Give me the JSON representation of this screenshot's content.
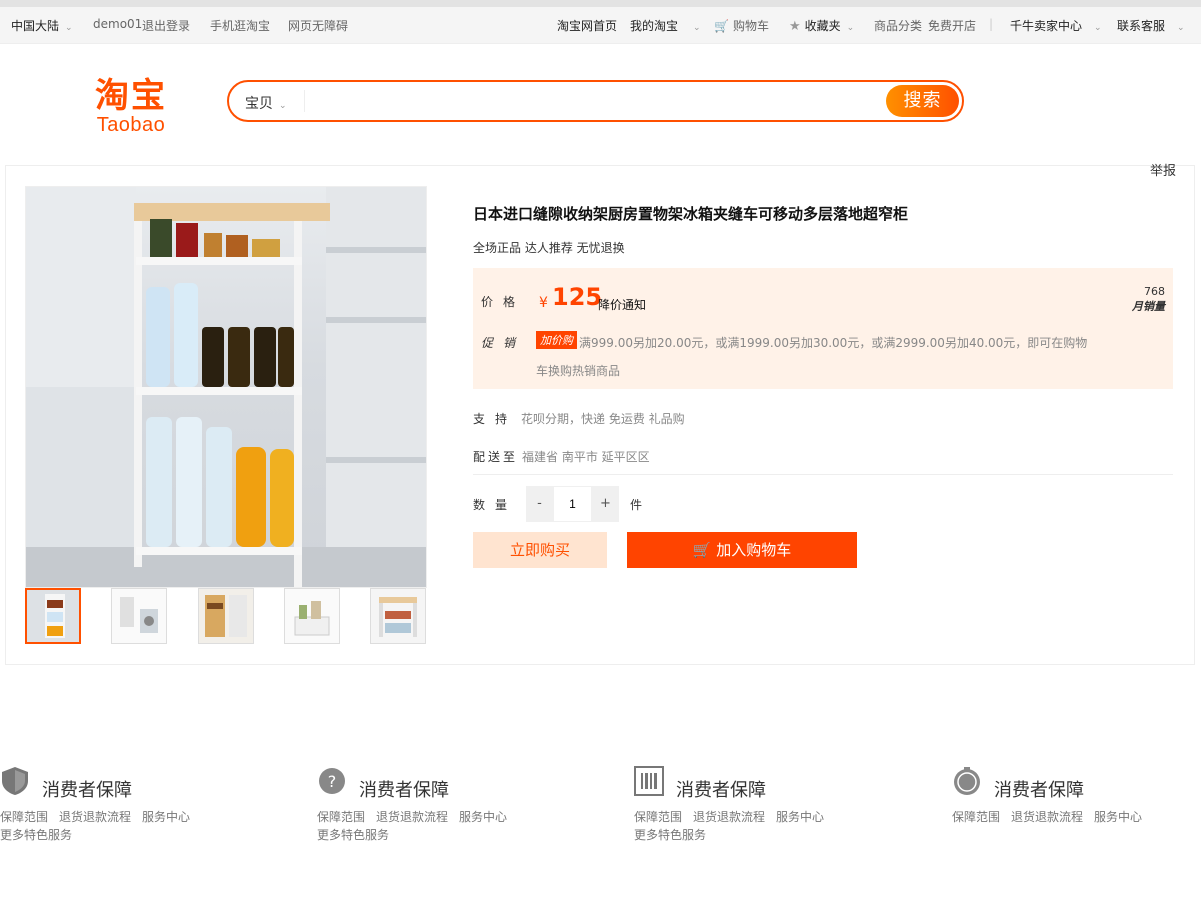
{
  "topbar": {
    "region": "中国大陆",
    "user": "demo01",
    "logout": "退出登录",
    "mobile": "手机逛淘宝",
    "accessible": "网页无障碍",
    "home": "淘宝网首页",
    "my_taobao": "我的淘宝",
    "cart": "购物车",
    "favorites": "收藏夹",
    "categories": "商品分类",
    "open_shop": "免费开店",
    "seller_center": "千牛卖家中心",
    "contact": "联系客服"
  },
  "header": {
    "logo_zh": "淘宝",
    "logo_en": "Taobao",
    "search_category": "宝贝",
    "search_placeholder": "",
    "search_button": "搜索"
  },
  "product": {
    "report": "举报",
    "title": "日本进口缝隙收纳架厨房置物架冰箱夹缝车可移动多层落地超窄柜",
    "subtitle": "全场正品 达人推荐 无忧退换",
    "price_label": "价格",
    "currency": "¥",
    "price": "125",
    "price_notice": "降价通知",
    "monthly_sales": "768",
    "monthly_sales_label": "月销量",
    "promo_label": "促销",
    "promo_tag": "加价购",
    "promo_text": "满999.00另加20.00元，或满1999.00另加30.00元，或满2999.00另加40.00元，即可在购物",
    "promo_text2": "车换购热销商品",
    "support_label": "支持",
    "support_value": "花呗分期，快递 免运费 礼品购",
    "ship_label": "配送至",
    "ship_value": "福建省 南平市 延平区区",
    "qty_label": "数量",
    "qty_minus": "-",
    "qty_value": "1",
    "qty_plus": "+",
    "qty_unit": "件",
    "buy_now": "立即购买",
    "add_to_cart": "加入购物车"
  },
  "footer": {
    "guarantees": [
      {
        "title": "消费者保障",
        "links": [
          "保障范围",
          "退货退款流程",
          "服务中心"
        ],
        "more": "更多特色服务",
        "icon": "shield-icon"
      },
      {
        "title": "消费者保障",
        "links": [
          "保障范围",
          "退货退款流程",
          "服务中心"
        ],
        "more": "更多特色服务",
        "icon": "question-icon"
      },
      {
        "title": "消费者保障",
        "links": [
          "保障范围",
          "退货退款流程",
          "服务中心"
        ],
        "more": "更多特色服务",
        "icon": "barcode-icon"
      },
      {
        "title": "消费者保障",
        "links": [
          "保障范围",
          "退货退款流程",
          "服务中心"
        ],
        "more": "",
        "icon": "stamp-icon"
      }
    ]
  },
  "colors": {
    "brand": "#ff5000",
    "price": "#ff4400",
    "pricebox_bg": "#fff2e8"
  }
}
